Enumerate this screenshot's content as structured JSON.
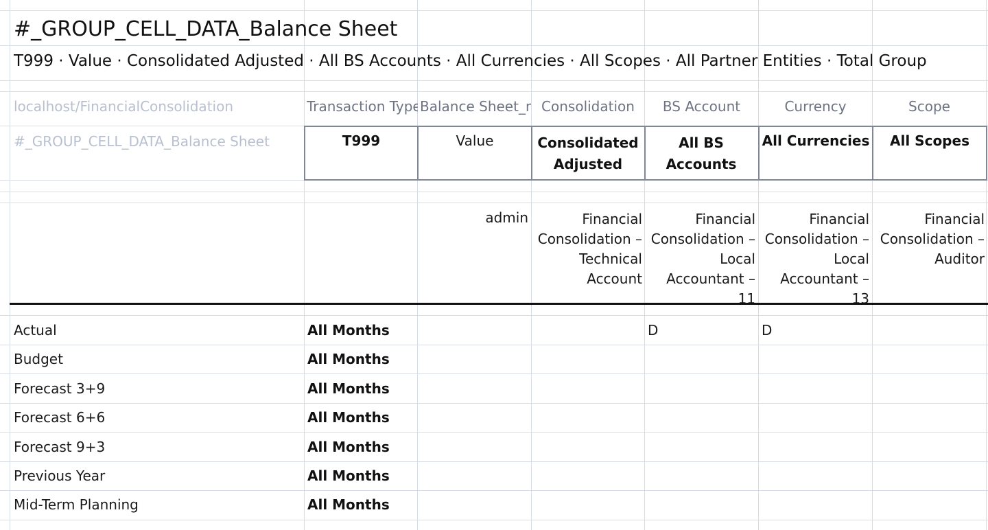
{
  "report": {
    "title": "#_GROUP_CELL_DATA_Balance Sheet",
    "subtitle": "T999 · Value · Consolidated Adjusted · All BS Accounts · All Currencies · All Scopes · All Partner Entities · Total Group"
  },
  "header_row": {
    "connection": "localhost/FinancialConsolidation",
    "columns": [
      "Transaction Type",
      "Balance Sheet_m",
      "Consolidation",
      "BS Account",
      "Currency",
      "Scope"
    ]
  },
  "selection_row": {
    "report_name": "#_GROUP_CELL_DATA_Balance Sheet",
    "values": [
      "T999",
      "Value",
      "Consolidated Adjusted",
      "All BS Accounts",
      "All Currencies",
      "All Scopes"
    ]
  },
  "owner_row": {
    "values": [
      "",
      "admin",
      "Financial Consolidation – Technical Account",
      "Financial Consolidation – Local Accountant – 11",
      "Financial Consolidation – Local Accountant – 13",
      "Financial Consolidation – Auditor"
    ]
  },
  "data_rows": [
    {
      "label": "Actual",
      "period": "All Months",
      "col_bs": "D",
      "col_currency": "D"
    },
    {
      "label": "Budget",
      "period": "All Months",
      "col_bs": "",
      "col_currency": ""
    },
    {
      "label": "Forecast 3+9",
      "period": "All Months",
      "col_bs": "",
      "col_currency": ""
    },
    {
      "label": "Forecast 6+6",
      "period": "All Months",
      "col_bs": "",
      "col_currency": ""
    },
    {
      "label": "Forecast 9+3",
      "period": "All Months",
      "col_bs": "",
      "col_currency": ""
    },
    {
      "label": "Previous Year",
      "period": "All Months",
      "col_bs": "",
      "col_currency": ""
    },
    {
      "label": "Mid-Term Planning",
      "period": "All Months",
      "col_bs": "",
      "col_currency": ""
    }
  ],
  "colors": {
    "gridline": "#d6dbe6",
    "faint_text": "#b8c0d0",
    "header_text": "#6d7383",
    "box_border": "#7f8796"
  }
}
